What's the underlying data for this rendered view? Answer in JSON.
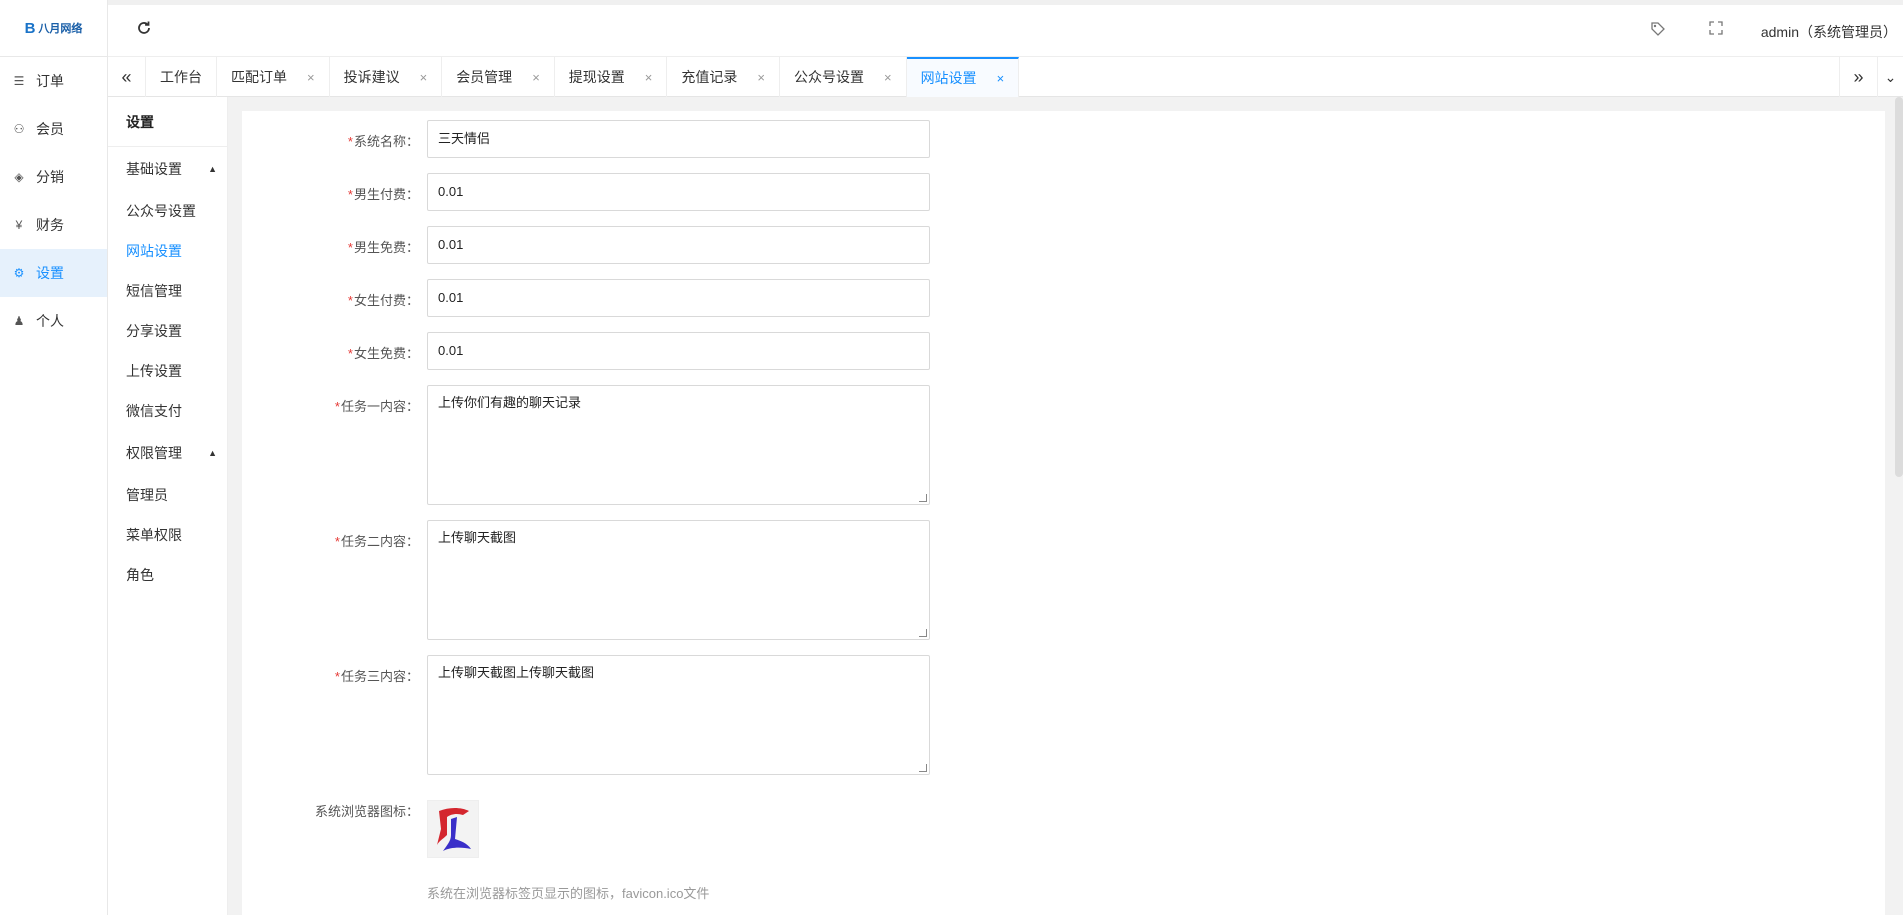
{
  "logo": {
    "mark": "B",
    "text": "八月网络"
  },
  "nav": [
    {
      "icon": "list-icon",
      "glyph": "☰",
      "label": "订单",
      "active": false
    },
    {
      "icon": "user-icon",
      "glyph": "⚇",
      "label": "会员",
      "active": false
    },
    {
      "icon": "layers-icon",
      "glyph": "◈",
      "label": "分销",
      "active": false
    },
    {
      "icon": "yen-icon",
      "glyph": "¥",
      "label": "财务",
      "active": false
    },
    {
      "icon": "gear-icon",
      "glyph": "⚙",
      "label": "设置",
      "active": true
    },
    {
      "icon": "person-icon",
      "glyph": "♟",
      "label": "个人",
      "active": false
    }
  ],
  "header": {
    "user": "admin（系统管理员）"
  },
  "tabs": [
    {
      "label": "工作台",
      "closable": false,
      "active": false
    },
    {
      "label": "匹配订单",
      "closable": true,
      "active": false
    },
    {
      "label": "投诉建议",
      "closable": true,
      "active": false
    },
    {
      "label": "会员管理",
      "closable": true,
      "active": false
    },
    {
      "label": "提现设置",
      "closable": true,
      "active": false
    },
    {
      "label": "充值记录",
      "closable": true,
      "active": false
    },
    {
      "label": "公众号设置",
      "closable": true,
      "active": false
    },
    {
      "label": "网站设置",
      "closable": true,
      "active": true
    }
  ],
  "subnav": {
    "title": "设置",
    "groups": [
      {
        "label": "基础设置",
        "items": [
          {
            "label": "公众号设置",
            "active": false
          },
          {
            "label": "网站设置",
            "active": true
          },
          {
            "label": "短信管理",
            "active": false
          },
          {
            "label": "分享设置",
            "active": false
          },
          {
            "label": "上传设置",
            "active": false
          },
          {
            "label": "微信支付",
            "active": false
          }
        ]
      },
      {
        "label": "权限管理",
        "items": [
          {
            "label": "管理员",
            "active": false
          },
          {
            "label": "菜单权限",
            "active": false
          },
          {
            "label": "角色",
            "active": false
          }
        ]
      }
    ]
  },
  "form": {
    "system_name": {
      "label": "系统名称：",
      "value": "三天情侣"
    },
    "male_paid": {
      "label": "男生付费：",
      "value": "0.01"
    },
    "male_free": {
      "label": "男生免费：",
      "value": "0.01"
    },
    "female_paid": {
      "label": "女生付费：",
      "value": "0.01"
    },
    "female_free": {
      "label": "女生免费：",
      "value": "0.01"
    },
    "task1": {
      "label": "任务一内容：",
      "value": "上传你们有趣的聊天记录"
    },
    "task2": {
      "label": "任务二内容：",
      "value": "上传聊天截图"
    },
    "task3": {
      "label": "任务三内容：",
      "value": "上传聊天截图上传聊天截图"
    },
    "favicon": {
      "label": "系统浏览器图标：",
      "hint": "系统在浏览器标签页显示的图标，favicon.ico文件"
    }
  },
  "colors": {
    "accent": "#1890ff",
    "required": "#e53935",
    "logo_red": "#d4262e",
    "logo_blue": "#3a2fc9"
  }
}
